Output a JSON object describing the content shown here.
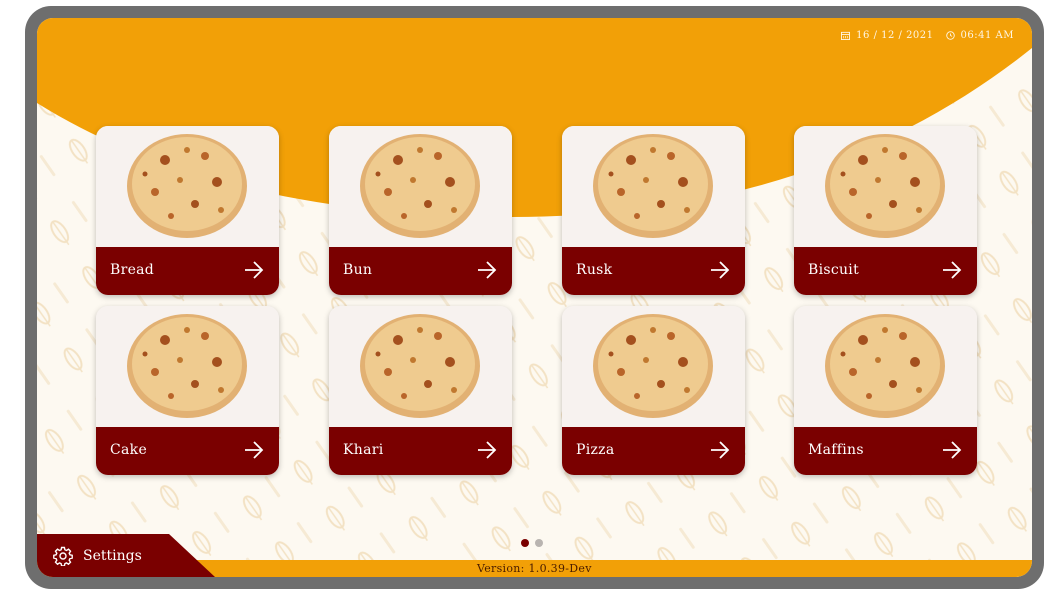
{
  "status": {
    "date": "16 / 12 / 2021",
    "time": "06:41 AM",
    "calendar_icon": "calendar-icon",
    "clock_icon": "clock-icon"
  },
  "categories": [
    {
      "label": "Bread",
      "icon": "arrow-right-icon"
    },
    {
      "label": "Bun",
      "icon": "arrow-right-icon"
    },
    {
      "label": "Rusk",
      "icon": "arrow-right-icon"
    },
    {
      "label": "Biscuit",
      "icon": "arrow-right-icon"
    },
    {
      "label": "Cake",
      "icon": "arrow-right-icon"
    },
    {
      "label": "Khari",
      "icon": "arrow-right-icon"
    },
    {
      "label": "Pizza",
      "icon": "arrow-right-icon"
    },
    {
      "label": "Maffins",
      "icon": "arrow-right-icon"
    }
  ],
  "pagination": {
    "current_page": 1,
    "total_pages": 2
  },
  "footer": {
    "settings_label": "Settings",
    "settings_icon": "gear-icon",
    "version": "Version: 1.0.39-Dev"
  },
  "colors": {
    "accent": "#f2a007",
    "brand": "#7a0000",
    "background": "#fdf9f1"
  }
}
